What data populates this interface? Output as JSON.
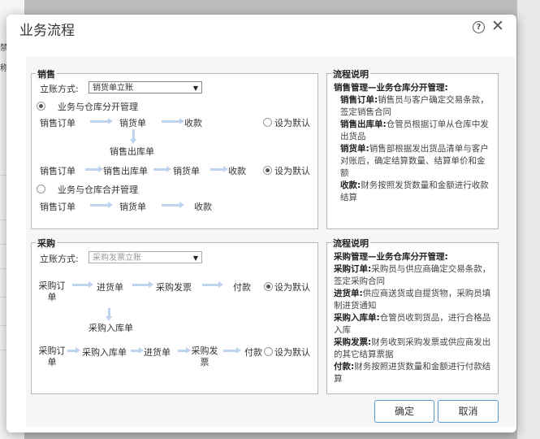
{
  "dialog": {
    "title": "业务流程",
    "help_icon": "?",
    "close_icon": "✕",
    "ok_label": "确定",
    "cancel_label": "取消"
  },
  "background": {
    "left_snippets": [
      "禁止",
      "称"
    ]
  },
  "sales": {
    "legend": "销售",
    "mode_label": "立账方式:",
    "mode_value": "销货单立账",
    "option1": {
      "label": "业务与仓库分开管理",
      "row1": [
        "销售订单",
        "销货单",
        "收款"
      ],
      "below": "销售出库单",
      "row2": [
        "销售订单",
        "销售出库单",
        "销货单",
        "收款"
      ],
      "default1": "设为默认",
      "default2": "设为默认"
    },
    "option2": {
      "label": "业务与仓库合并管理",
      "row": [
        "销售订单",
        "销货单",
        "收款"
      ]
    }
  },
  "sales_desc": {
    "legend": "流程说明",
    "heading": "销售管理—业务仓库分开管理:",
    "items": [
      {
        "term": "销售订单:",
        "text": "销售员与客户确定交易条款，签定销售合同"
      },
      {
        "term": "销售出库单:",
        "text": "仓管员根据订单从仓库中发出货品"
      },
      {
        "term": "销货单:",
        "text": "销售部根据发出货品清单与客户对账后，确定结算数量、结算单价和金额"
      },
      {
        "term": "收款:",
        "text": "财务按照发货数量和金额进行收款结算"
      }
    ]
  },
  "purchase": {
    "legend": "采购",
    "mode_label": "立账方式:",
    "mode_value": "采购发票立账",
    "row1": [
      "采购订单",
      "进货单",
      "采购发票",
      "付款"
    ],
    "below": "采购入库单",
    "row2": [
      "采购订单",
      "采购入库单",
      "进货单",
      "采购发票",
      "付款"
    ],
    "default1": "设为默认",
    "default2": "设为默认"
  },
  "purchase_desc": {
    "legend": "流程说明",
    "heading": "采购管理—业务仓库分开管理:",
    "items": [
      {
        "term": "采购订单:",
        "text": "采购员与供应商确定交易条款，签定采购合同"
      },
      {
        "term": "进货单:",
        "text": "供应商送货或自提货物，采购员填制进货通知"
      },
      {
        "term": "采购入库单:",
        "text": "仓管员收到货品，进行合格品入库"
      },
      {
        "term": "采购发票:",
        "text": "财务收到采购发票或供应商发出的其它结算票据"
      },
      {
        "term": "付款:",
        "text": "财务按照进货数量和金额进行付款结算"
      }
    ]
  }
}
